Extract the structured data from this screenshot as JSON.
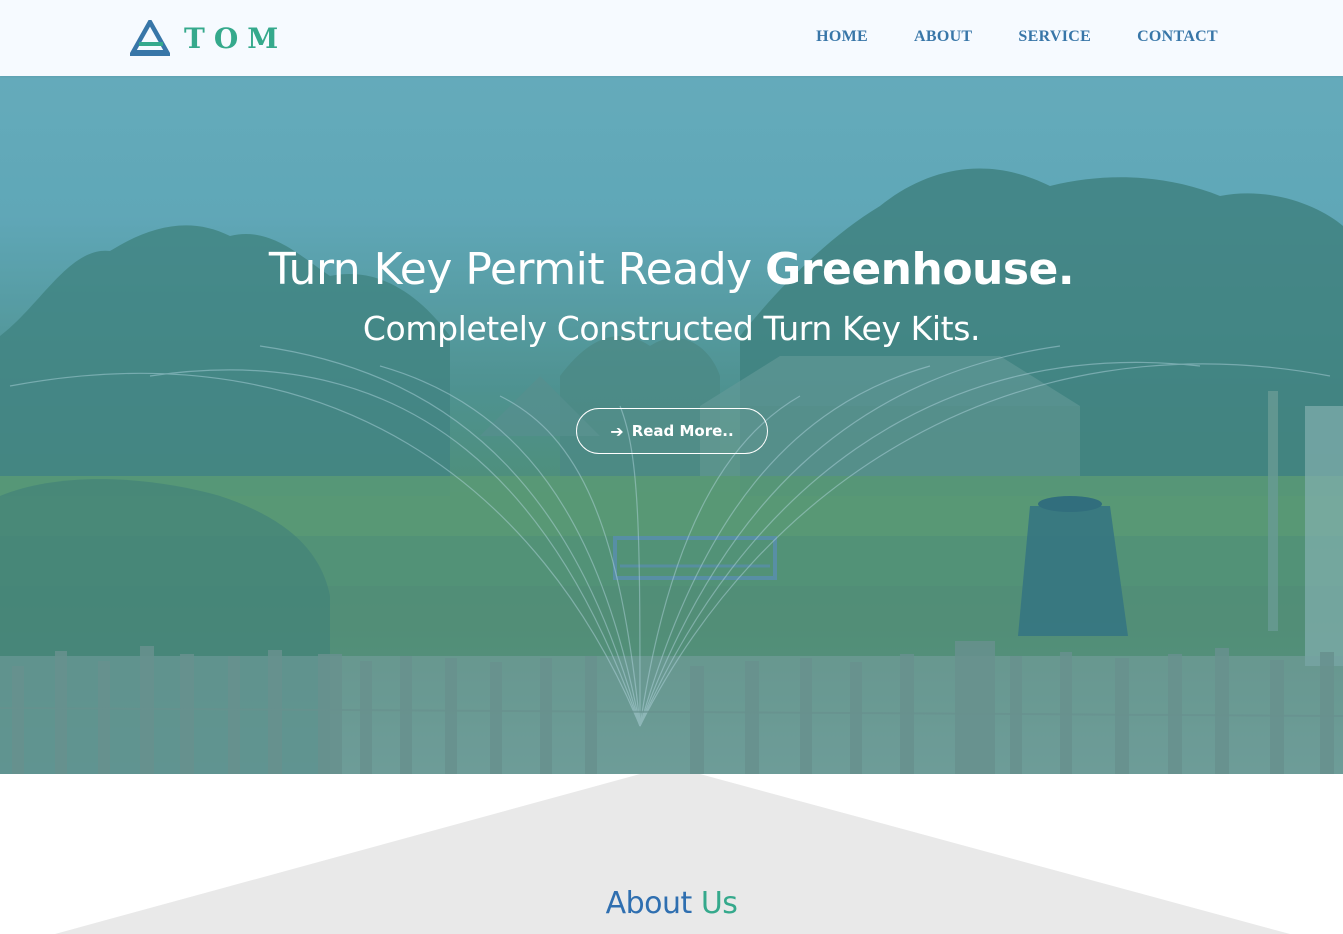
{
  "brand": {
    "name": "TOM",
    "primary_color": "#3876a8",
    "accent_color": "#35a98c"
  },
  "nav": {
    "items": [
      {
        "label": "HOME"
      },
      {
        "label": "ABOUT"
      },
      {
        "label": "SERVICE"
      },
      {
        "label": "CONTACT"
      }
    ]
  },
  "hero": {
    "title_regular": "Turn Key Permit Ready",
    "title_bold": "Greenhouse.",
    "subtitle": "Completely Constructed Turn Key Kits.",
    "button_label": "Read More..",
    "button_icon": "arrow-right-icon"
  },
  "about": {
    "title_word1": "About",
    "title_word2": "Us"
  }
}
